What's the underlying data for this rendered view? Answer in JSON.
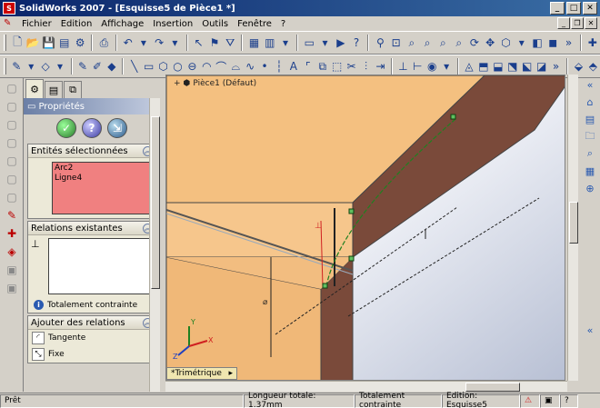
{
  "window": {
    "title": "SolidWorks 2007 - [Esquisse5 de Pièce1 *]",
    "app_icon": "solidworks-logo"
  },
  "menu": {
    "items": [
      "Fichier",
      "Edition",
      "Affichage",
      "Insertion",
      "Outils",
      "Fenêtre",
      "?"
    ]
  },
  "property_manager": {
    "header": "Propriétés",
    "selected_entities": {
      "title": "Entités sélectionnées",
      "items": [
        "Arc2",
        "Ligne4"
      ]
    },
    "existing_relations": {
      "title": "Relations existantes",
      "status": "Totalement contrainte"
    },
    "add_relations": {
      "title": "Ajouter des relations",
      "items": [
        "Tangente",
        "Fixe"
      ]
    }
  },
  "viewport": {
    "tree_label": "Pièce1 (Défaut)",
    "view_tab": "*Trimétrique"
  },
  "statusbar": {
    "left": "Prêt",
    "total_length": "Longueur totale: 1.37mm",
    "constraint": "Totalement contrainte",
    "mode": "Edition: Esquisse5"
  },
  "colors": {
    "title_bar": "#0a246a",
    "selection_box": "#f08080",
    "face_top": "#f4c080",
    "face_side": "#7a4a3a",
    "sketch_green": "#208020"
  }
}
